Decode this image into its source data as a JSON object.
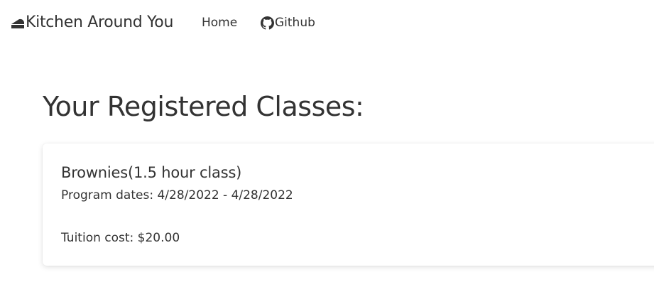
{
  "navbar": {
    "brand_icon": "cake-icon",
    "brand_label": "Kitchen Around You",
    "home_label": "Home",
    "github_icon": "github-icon",
    "github_label": "Github"
  },
  "main": {
    "heading": "Your Registered Classes:",
    "classes": [
      {
        "title": "Brownies(1.5 hour class)",
        "dates_label": "Program dates:",
        "dates_value": "4/28/2022 - 4/28/2022",
        "cost_label": "Tuition cost:",
        "cost_value": "$20.00"
      }
    ]
  },
  "colors": {
    "text": "#333333",
    "background": "#ffffff"
  }
}
